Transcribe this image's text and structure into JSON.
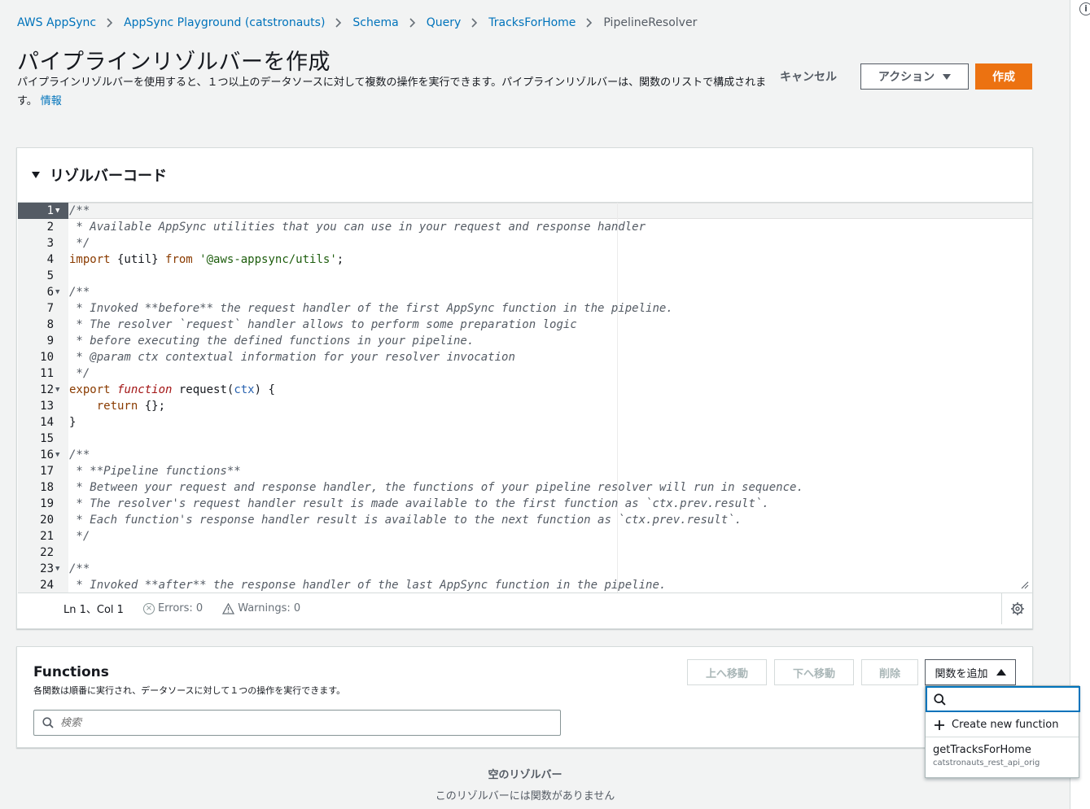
{
  "breadcrumb": {
    "items": [
      "AWS AppSync",
      "AppSync Playground (catstronauts)",
      "Schema",
      "Query",
      "TracksForHome"
    ],
    "current": "PipelineResolver"
  },
  "header": {
    "title": "パイプラインリゾルバーを作成",
    "description": "パイプラインリゾルバーを使用すると、１つ以上のデータソースに対して複数の操作を実行できます。パイプラインリゾルバーは、関数のリストで構成されます。",
    "info_link": "情報",
    "cancel_label": "キャンセル",
    "action_label": "アクション",
    "create_label": "作成"
  },
  "resolver_code": {
    "title": "リゾルバーコード",
    "lines": [
      {
        "n": "1",
        "fold": true,
        "parts": [
          [
            "c",
            "/**"
          ]
        ]
      },
      {
        "n": "2",
        "fold": false,
        "parts": [
          [
            "c",
            " * Available AppSync utilities that you can use in your request and response handler"
          ]
        ]
      },
      {
        "n": "3",
        "fold": false,
        "parts": [
          [
            "c",
            " */"
          ]
        ]
      },
      {
        "n": "4",
        "fold": false,
        "parts": [
          [
            "k",
            "import"
          ],
          [
            "t",
            " {util} "
          ],
          [
            "k",
            "from"
          ],
          [
            "t",
            " "
          ],
          [
            "s",
            "'@aws-appsync/utils'"
          ],
          [
            "t",
            ";"
          ]
        ]
      },
      {
        "n": "5",
        "fold": false,
        "parts": []
      },
      {
        "n": "6",
        "fold": true,
        "parts": [
          [
            "c",
            "/**"
          ]
        ]
      },
      {
        "n": "7",
        "fold": false,
        "parts": [
          [
            "c",
            " * Invoked **before** the request handler of the first AppSync function in the pipeline."
          ]
        ]
      },
      {
        "n": "8",
        "fold": false,
        "parts": [
          [
            "c",
            " * The resolver `request` handler allows to perform some preparation logic"
          ]
        ]
      },
      {
        "n": "9",
        "fold": false,
        "parts": [
          [
            "c",
            " * before executing the defined functions in your pipeline."
          ]
        ]
      },
      {
        "n": "10",
        "fold": false,
        "parts": [
          [
            "c",
            " * @param ctx contextual information for your resolver invocation"
          ]
        ]
      },
      {
        "n": "11",
        "fold": false,
        "parts": [
          [
            "c",
            " */"
          ]
        ]
      },
      {
        "n": "12",
        "fold": true,
        "parts": [
          [
            "k",
            "export"
          ],
          [
            "t",
            " "
          ],
          [
            "f",
            "function"
          ],
          [
            "t",
            " request("
          ],
          [
            "p",
            "ctx"
          ],
          [
            "t",
            ") {"
          ]
        ]
      },
      {
        "n": "13",
        "fold": false,
        "parts": [
          [
            "t",
            "    "
          ],
          [
            "k",
            "return"
          ],
          [
            "t",
            " {};"
          ]
        ]
      },
      {
        "n": "14",
        "fold": false,
        "parts": [
          [
            "t",
            "}"
          ]
        ]
      },
      {
        "n": "15",
        "fold": false,
        "parts": []
      },
      {
        "n": "16",
        "fold": true,
        "parts": [
          [
            "c",
            "/**"
          ]
        ]
      },
      {
        "n": "17",
        "fold": false,
        "parts": [
          [
            "c",
            " * **Pipeline functions**"
          ]
        ]
      },
      {
        "n": "18",
        "fold": false,
        "parts": [
          [
            "c",
            " * Between your request and response handler, the functions of your pipeline resolver will run in sequence."
          ]
        ]
      },
      {
        "n": "19",
        "fold": false,
        "parts": [
          [
            "c",
            " * The resolver's request handler result is made available to the first function as `ctx.prev.result`."
          ]
        ]
      },
      {
        "n": "20",
        "fold": false,
        "parts": [
          [
            "c",
            " * Each function's response handler result is available to the next function as `ctx.prev.result`."
          ]
        ]
      },
      {
        "n": "21",
        "fold": false,
        "parts": [
          [
            "c",
            " */"
          ]
        ]
      },
      {
        "n": "22",
        "fold": false,
        "parts": []
      },
      {
        "n": "23",
        "fold": true,
        "parts": [
          [
            "c",
            "/**"
          ]
        ]
      },
      {
        "n": "24",
        "fold": false,
        "parts": [
          [
            "c",
            " * Invoked **after** the response handler of the last AppSync function in the pipeline."
          ]
        ]
      }
    ],
    "status": {
      "position": "Ln 1、Col 1",
      "errors": "Errors: 0",
      "warnings": "Warnings: 0"
    }
  },
  "functions": {
    "title": "Functions",
    "description": "各関数は順番に実行され、データソースに対して１つの操作を実行できます。",
    "search_placeholder": "検索",
    "move_up_label": "上へ移動",
    "move_down_label": "下へ移動",
    "delete_label": "削除",
    "add_label": "関数を追加",
    "dropdown": {
      "search_value": "",
      "create_label": "Create new function",
      "items": [
        {
          "name": "getTracksForHome",
          "datasource": "catstronauts_rest_api_orig"
        }
      ]
    }
  },
  "empty_state": {
    "title": "空のリゾルバー",
    "description": "このリゾルバーには関数がありません"
  },
  "colors": {
    "link": "#0073bb",
    "primary": "#ec7211",
    "background": "#f2f3f3"
  }
}
